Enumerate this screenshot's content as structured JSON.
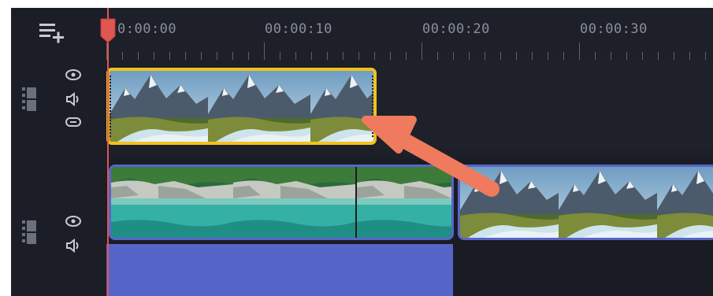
{
  "timeline": {
    "ruler": {
      "labels": [
        "0:00:00",
        "00:00:10",
        "00:00:20",
        "00:00:30"
      ]
    },
    "toolbar": {
      "add_track_icon": "add-track-icon"
    },
    "tracks": [
      {
        "name": "overlay-track",
        "icons": [
          "eye-icon",
          "speaker-icon",
          "link-icon"
        ],
        "clips": [
          {
            "name": "mountain-river-clip",
            "selected": true
          }
        ]
      },
      {
        "name": "main-track",
        "icons": [
          "eye-icon",
          "speaker-icon"
        ],
        "clips": [
          {
            "name": "lake-clip"
          },
          {
            "name": "mountain-river-clip-2"
          }
        ]
      }
    ],
    "colors": {
      "background": "#1b1e26",
      "playhead": "#e05652",
      "selection": "#f2c21b",
      "clip_border": "#5865c9",
      "audio_bar": "#5565c8",
      "arrow": "#ef7a5d"
    }
  }
}
